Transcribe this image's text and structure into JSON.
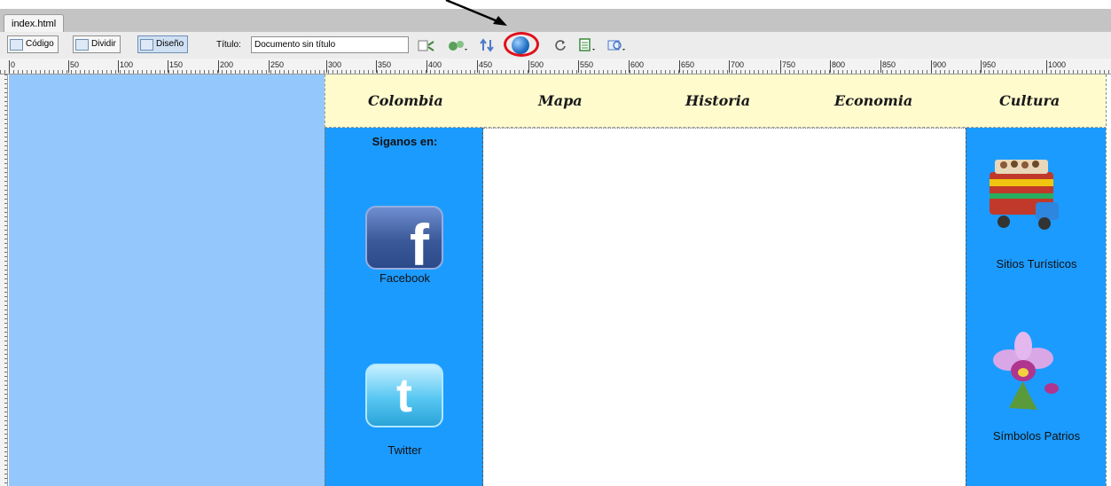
{
  "tab": {
    "filename": "index.html"
  },
  "toolbar": {
    "code_label": "Código",
    "split_label": "Dividir",
    "design_label": "Diseño",
    "title_label": "Título:",
    "title_value": "Documento sin título"
  },
  "ruler": {
    "ticks": [
      "0",
      "50",
      "100",
      "150",
      "200",
      "250",
      "300",
      "350",
      "400",
      "450",
      "500",
      "550",
      "600",
      "650",
      "700",
      "750",
      "800",
      "850",
      "900",
      "950",
      "1000"
    ]
  },
  "nav": {
    "items": [
      "Colombia",
      "Mapa",
      "Historia",
      "Economia",
      "Cultura"
    ]
  },
  "left": {
    "heading": "Siganos en:",
    "facebook": "Facebook",
    "twitter": "Twitter"
  },
  "right": {
    "sitios": "Sitios Turísticos",
    "simbolos": "Símbolos Patrios"
  },
  "colors": {
    "canvas_blue": "#94c8fc",
    "column_blue": "#1c9bff",
    "nav_bg": "#fffbcd",
    "highlight_red": "#e0101c"
  }
}
